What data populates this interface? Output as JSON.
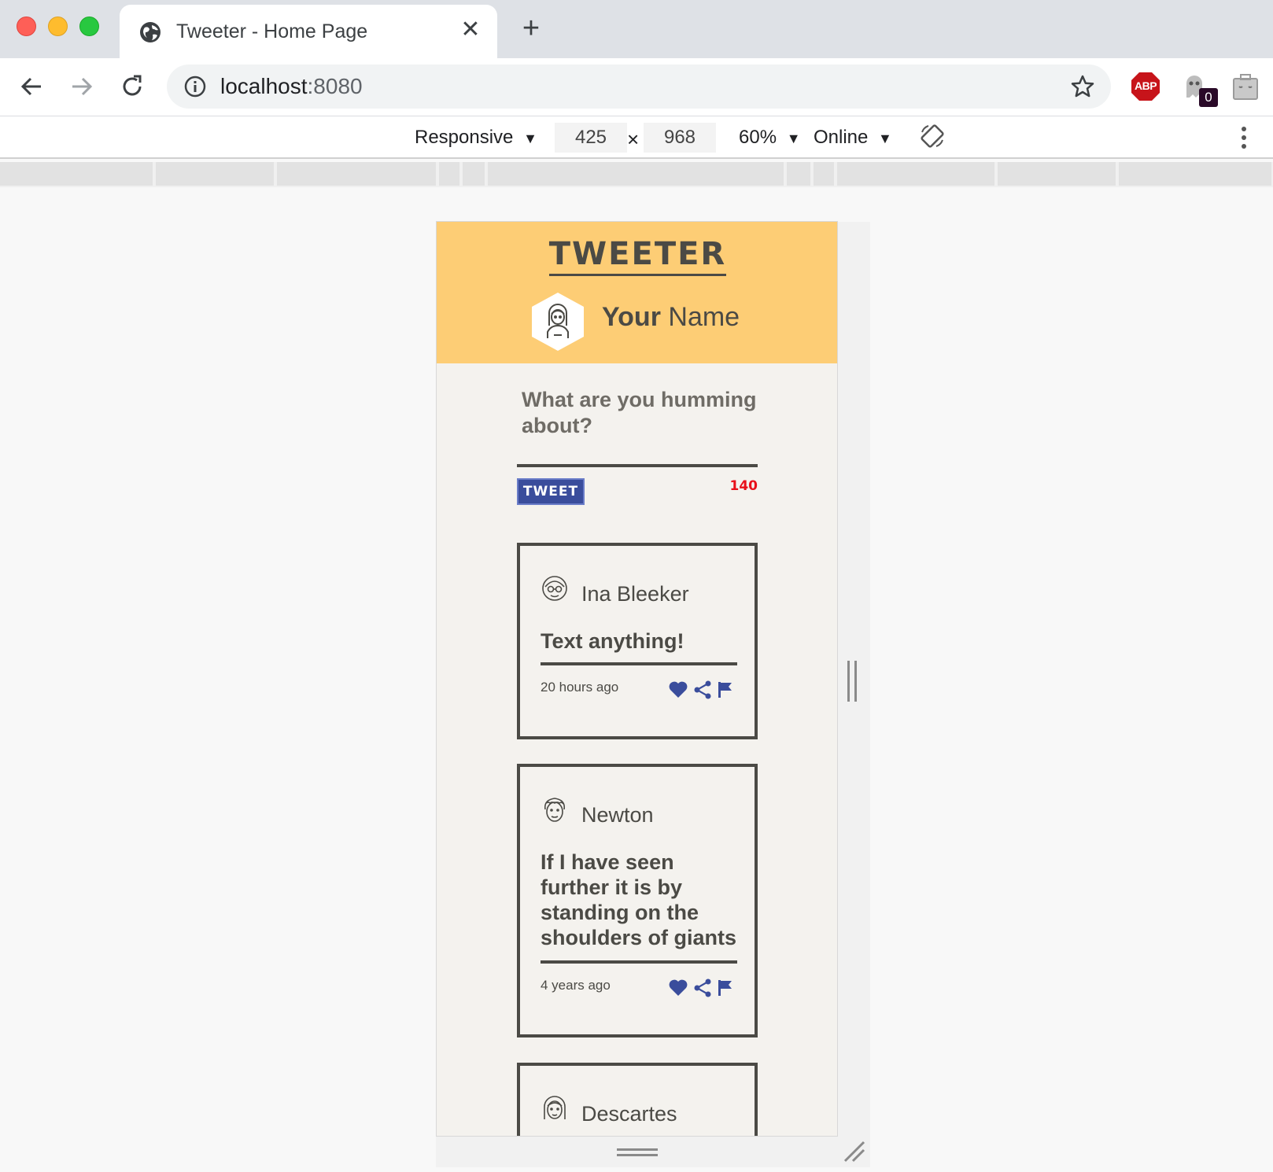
{
  "browser": {
    "tab_title": "Tweeter - Home Page",
    "new_tab_symbol": "+",
    "close_symbol": "✕",
    "url_host": "localhost",
    "url_port": ":8080",
    "extensions": {
      "adblock_label": "ABP",
      "ghostery_count": "0"
    }
  },
  "devtools": {
    "device": "Responsive",
    "width": "425",
    "times": "×",
    "height": "968",
    "zoom": "60%",
    "network": "Online",
    "dropdown_arrow": "▼"
  },
  "app": {
    "brand": "TWEETER",
    "profile": {
      "first": "Your",
      "last": "Name"
    },
    "compose": {
      "placeholder": "What are you humming about?",
      "button": "TWEET",
      "char_count": "140"
    },
    "tweets": [
      {
        "author": "Ina Bleeker",
        "text": "Text anything!",
        "time": "20 hours ago",
        "avatar_icon": "glasses-face-icon"
      },
      {
        "author": "Newton",
        "text": "If I have seen further it is by standing on the shoulders of giants",
        "time": "4 years ago",
        "avatar_icon": "curly-hair-face-icon"
      },
      {
        "author": "Descartes",
        "text": "",
        "time": "",
        "avatar_icon": "long-hair-face-icon"
      }
    ]
  },
  "colors": {
    "header_bg": "#fdcd75",
    "body_bg": "#f4f2ee",
    "ink": "#4b4a45",
    "button_blue": "#3a4d9c",
    "counter_red": "#e8101a"
  }
}
